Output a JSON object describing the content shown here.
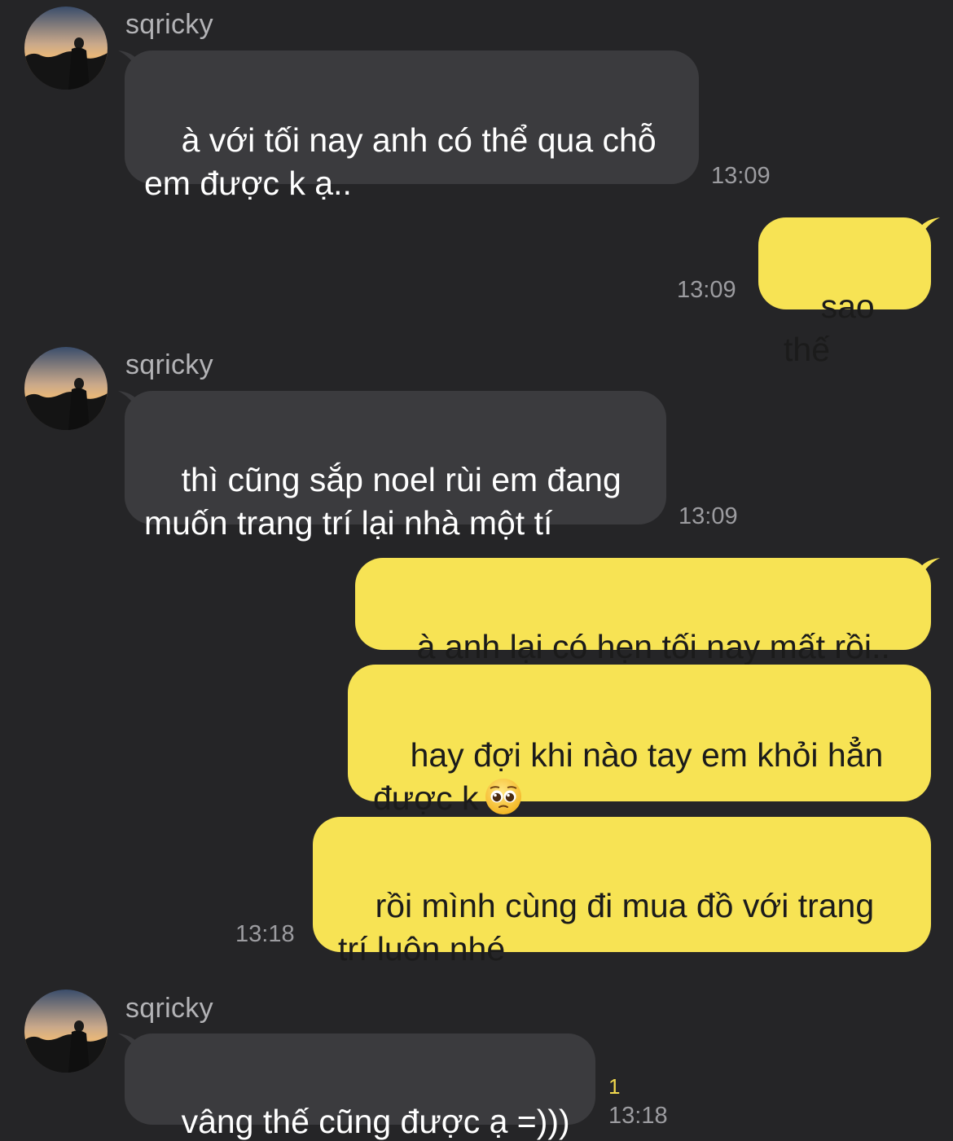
{
  "colors": {
    "background": "#252527",
    "incoming_bubble": "#3b3b3e",
    "outgoing_bubble": "#f7e354",
    "timestamp": "#9c9ca0",
    "unread": "#f2d94e"
  },
  "messages": [
    {
      "id": "m1",
      "direction": "incoming",
      "sender": "sqricky",
      "avatar_icon": "profile-photo-sunset",
      "text": "à với tối nay anh có thể qua chỗ\nem được k ạ..",
      "time": "13:09"
    },
    {
      "id": "m2",
      "direction": "outgoing",
      "text": "sao thế",
      "time": "13:09"
    },
    {
      "id": "m3",
      "direction": "incoming",
      "sender": "sqricky",
      "avatar_icon": "profile-photo-sunset",
      "text": "thì cũng sắp noel rùi em đang\nmuốn trang trí lại nhà một tí",
      "time": "13:09"
    },
    {
      "id": "m4",
      "direction": "outgoing",
      "text": "à anh lại có hẹn tối nay mất rồi.."
    },
    {
      "id": "m5",
      "direction": "outgoing",
      "text": "hay đợi khi nào tay em khỏi hẳn\nđược k",
      "emoji": "pleading-face-emoji"
    },
    {
      "id": "m6",
      "direction": "outgoing",
      "text": "rồi mình cùng đi mua đồ với trang\ntrí luôn nhé",
      "time": "13:18"
    },
    {
      "id": "m7",
      "direction": "incoming",
      "sender": "sqricky",
      "avatar_icon": "profile-photo-sunset",
      "text": "vâng thế cũng được ạ =)))",
      "time": "13:18",
      "unread_count": "1"
    }
  ]
}
